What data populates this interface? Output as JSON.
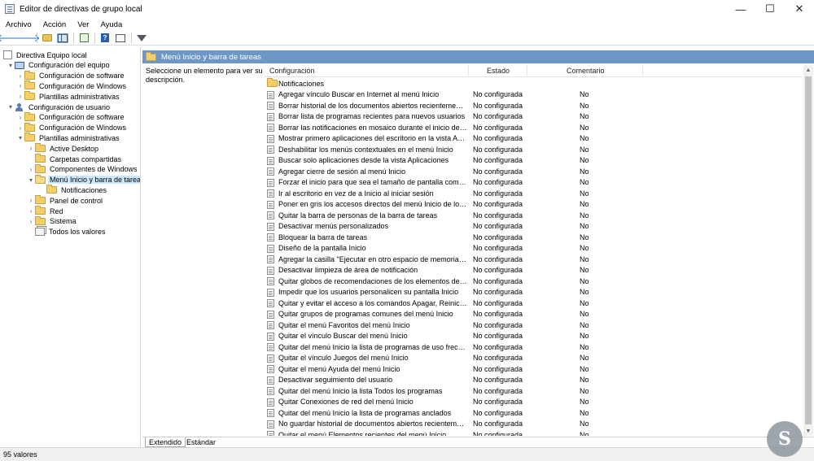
{
  "window": {
    "title": "Editor de directivas de grupo local",
    "controls": {
      "minimize": "—",
      "maximize": "☐",
      "close": "✕"
    }
  },
  "menubar": [
    "Archivo",
    "Acción",
    "Ver",
    "Ayuda"
  ],
  "toolbar": [
    "back-arrow-icon",
    "forward-arrow-icon",
    "up-folder-icon",
    "show-hide-tree-icon",
    "export-list-icon",
    "help-icon",
    "properties-icon",
    "filter-icon"
  ],
  "tree": {
    "items": [
      {
        "label": "Directiva Equipo local",
        "icon": "document-icon",
        "level": 0,
        "expand": ""
      },
      {
        "label": "Configuración del equipo",
        "icon": "computer-icon",
        "level": 1,
        "expand": "▾"
      },
      {
        "label": "Configuración de software",
        "icon": "folder-icon",
        "level": 2,
        "expand": "›"
      },
      {
        "label": "Configuración de Windows",
        "icon": "folder-icon",
        "level": 2,
        "expand": "›"
      },
      {
        "label": "Plantillas administrativas",
        "icon": "folder-icon",
        "level": 2,
        "expand": "›"
      },
      {
        "label": "Configuración de usuario",
        "icon": "user-icon",
        "level": 1,
        "expand": "▾"
      },
      {
        "label": "Configuración de software",
        "icon": "folder-icon",
        "level": 2,
        "expand": "›"
      },
      {
        "label": "Configuración de Windows",
        "icon": "folder-icon",
        "level": 2,
        "expand": "›"
      },
      {
        "label": "Plantillas administrativas",
        "icon": "folder-icon",
        "level": 2,
        "expand": "▾"
      },
      {
        "label": "Active Desktop",
        "icon": "folder-icon",
        "level": 3,
        "expand": "›"
      },
      {
        "label": "Carpetas compartidas",
        "icon": "folder-icon",
        "level": 3,
        "expand": ""
      },
      {
        "label": "Componentes de Windows",
        "icon": "folder-icon",
        "level": 3,
        "expand": "›"
      },
      {
        "label": "Menú Inicio y barra de tareas",
        "icon": "folder-open-icon",
        "level": 3,
        "expand": "▾",
        "selected": true
      },
      {
        "label": "Notificaciones",
        "icon": "folder-icon",
        "level": 4,
        "expand": ""
      },
      {
        "label": "Panel de control",
        "icon": "folder-icon",
        "level": 3,
        "expand": "›"
      },
      {
        "label": "Red",
        "icon": "folder-icon",
        "level": 3,
        "expand": "›"
      },
      {
        "label": "Sistema",
        "icon": "folder-icon",
        "level": 3,
        "expand": "›"
      },
      {
        "label": "Todos los valores",
        "icon": "all-settings-icon",
        "level": 3,
        "expand": ""
      }
    ]
  },
  "pane": {
    "header": "Menú Inicio y barra de tareas",
    "description": "Seleccione un elemento para ver su descripción.",
    "columns": {
      "name": "Configuración",
      "state": "Estado",
      "comment": "Comentario"
    },
    "folder_row": "Notificaciones",
    "rows": [
      [
        "Agregar vínculo Buscar en Internet al menú Inicio",
        "No configurada",
        "No"
      ],
      [
        "Borrar historial de los documentos abiertos recientemente al...",
        "No configurada",
        "No"
      ],
      [
        "Borrar lista de programas recientes para nuevos usuarios",
        "No configurada",
        "No"
      ],
      [
        "Borrar las notificaciones en mosaico durante el inicio de sesi",
        "No configurada",
        "No"
      ],
      [
        "Mostrar primero aplicaciones del escritorio en la vista Aplica...",
        "No configurada",
        "No"
      ],
      [
        "Deshabilitar los menús contextuales en el menú Inicio",
        "No configurada",
        "No"
      ],
      [
        "Buscar solo aplicaciones desde la vista Aplicaciones",
        "No configurada",
        "No"
      ],
      [
        "Agregar cierre de sesión al menú Inicio",
        "No configurada",
        "No"
      ],
      [
        "Forzar el inicio para que sea el tamaño de pantalla completa...",
        "No configurada",
        "No"
      ],
      [
        "Ir al escritorio en vez de a Inicio al iniciar sesión",
        "No configurada",
        "No"
      ],
      [
        "Poner en gris los accesos directos del menú Inicio de los pro...",
        "No configurada",
        "No"
      ],
      [
        "Quitar la barra de personas de la barra de tareas",
        "No configurada",
        "No"
      ],
      [
        "Desactivar menús personalizados",
        "No configurada",
        "No"
      ],
      [
        "Bloquear la barra de tareas",
        "No configurada",
        "No"
      ],
      [
        "Diseño de la pantalla Inicio",
        "No configurada",
        "No"
      ],
      [
        "Agregar la casilla \"Ejecutar en otro espacio de memoria\" al c...",
        "No configurada",
        "No"
      ],
      [
        "Desactivar limpieza de área de notificación",
        "No configurada",
        "No"
      ],
      [
        "Quitar globos de recomendaciones de los elementos del me...",
        "No configurada",
        "No"
      ],
      [
        "Impedir que los usuarios personalicen su pantalla Inicio",
        "No configurada",
        "No"
      ],
      [
        "Quitar y evitar el acceso a los comandos Apagar, Reiniciar, S...",
        "No configurada",
        "No"
      ],
      [
        "Quitar grupos de programas comunes del menú Inicio",
        "No configurada",
        "No"
      ],
      [
        "Quitar el menú Favoritos del menú Inicio",
        "No configurada",
        "No"
      ],
      [
        "Quitar el vínculo Buscar del menú Inicio",
        "No configurada",
        "No"
      ],
      [
        "Quitar del menú Inicio la lista de programas de uso frecuente",
        "No configurada",
        "No"
      ],
      [
        "Quitar el vínculo Juegos del menú Inicio",
        "No configurada",
        "No"
      ],
      [
        "Quitar el menú Ayuda del menú Inicio",
        "No configurada",
        "No"
      ],
      [
        "Desactivar seguimiento del usuario",
        "No configurada",
        "No"
      ],
      [
        "Quitar del menú Inicio la lista Todos los programas",
        "No configurada",
        "No"
      ],
      [
        "Quitar Conexiones de red del menú Inicio",
        "No configurada",
        "No"
      ],
      [
        "Quitar del menú Inicio la lista de programas anclados",
        "No configurada",
        "No"
      ],
      [
        "No guardar historial de documentos abiertos recientemente",
        "No configurada",
        "No"
      ],
      [
        "Quitar el menú Elementos recientes del menú Inicio",
        "No configurada",
        "No"
      ]
    ]
  },
  "tabs": [
    "Extendido",
    "Estándar"
  ],
  "status": "95 valores",
  "watermark": "S",
  "colors": {
    "header_bar": "#6f97c6",
    "selection": "#cce8ff",
    "folder": "#f3cf6c"
  }
}
